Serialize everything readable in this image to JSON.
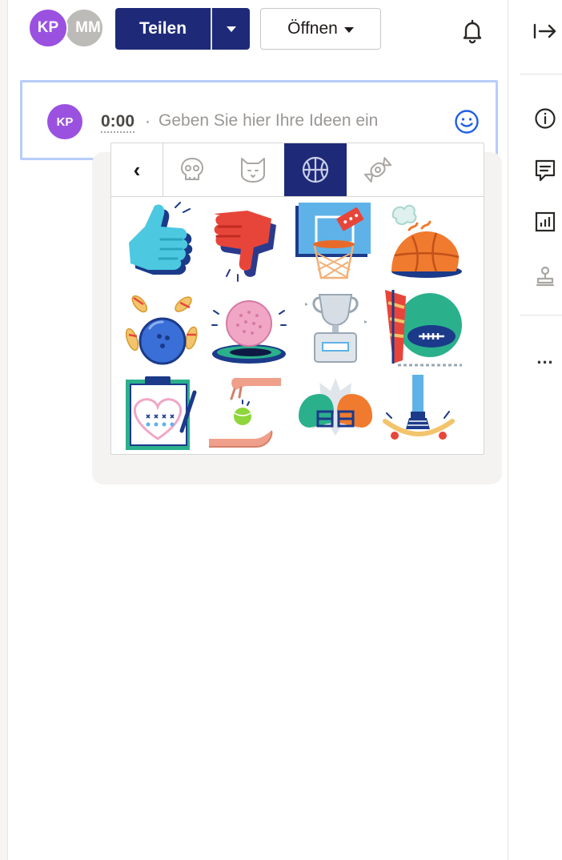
{
  "header": {
    "avatars": [
      {
        "initials": "KP",
        "color": "#9b51e0"
      },
      {
        "initials": "MM",
        "color": "#bdbbb8"
      }
    ],
    "share_label": "Teilen",
    "open_label": "Öffnen",
    "accent": "#1e2a78"
  },
  "right_rail": {
    "icons": [
      "collapse-arrow-icon",
      "info-icon",
      "comment-icon",
      "chart-icon",
      "stamp-icon"
    ],
    "more_label": "..."
  },
  "comment": {
    "avatar_initials": "KP",
    "timestamp": "0:00",
    "separator": "·",
    "placeholder": "Geben Sie hier Ihre Ideen ein",
    "focus_color": "#b7cdfb"
  },
  "sticker_picker": {
    "back_label": "‹",
    "tabs": [
      {
        "icon": "skull-icon",
        "selected": false
      },
      {
        "icon": "cat-icon",
        "selected": false
      },
      {
        "icon": "basketball-icon",
        "selected": true
      },
      {
        "icon": "candy-icon",
        "selected": false
      }
    ],
    "stickers": [
      "thumbs-up-foam-hand-sticker",
      "thumbs-down-foam-hand-sticker",
      "basketball-hoop-sticker",
      "smoking-basketball-sticker",
      "bowling-strike-sticker",
      "golf-ball-hole-sticker",
      "trophy-sticker",
      "football-pennant-sticker",
      "playbook-clipboard-sticker",
      "tennis-ball-catch-sticker",
      "helmet-clash-sticker",
      "skateboard-kickflip-sticker"
    ]
  }
}
